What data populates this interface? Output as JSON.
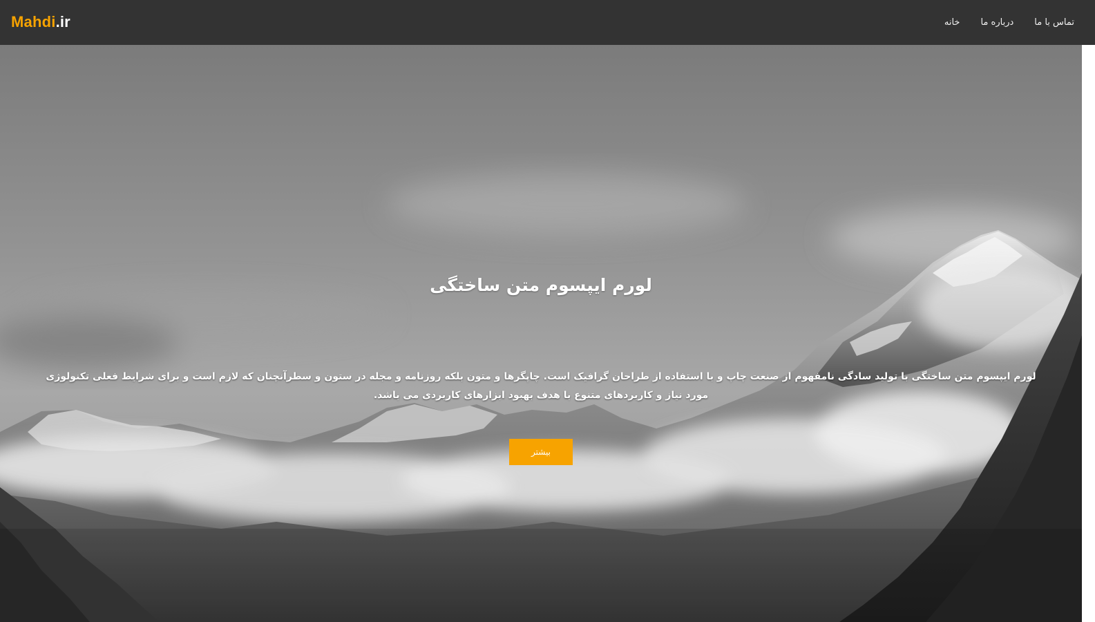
{
  "navbar": {
    "logo_main": "Mahdi",
    "logo_tld": ".ir",
    "links": [
      {
        "label": "خانه"
      },
      {
        "label": "درباره ما"
      },
      {
        "label": "تماس با ما"
      }
    ]
  },
  "hero": {
    "title": "لورم ایپسوم متن ساختگی",
    "text": "لورم ایپسوم متن ساختگی با تولید سادگی نامفهوم از صنعت چاپ و با استفاده از طراحان گرافیک است. چاپگرها و متون بلکه روزنامه و مجله در ستون و سطرآنچنان که لازم است و برای شرایط فعلی تکنولوژی مورد نیاز و کاربردهای متنوع با هدف بهبود ابزارهای کاربردی می باشد.",
    "button_label": "بیشتر",
    "background": "grayscale mountain landscape with clouds"
  },
  "colors": {
    "navbar_bg": "#333333",
    "accent": "#f7a300",
    "text_light": "#ffffff"
  }
}
